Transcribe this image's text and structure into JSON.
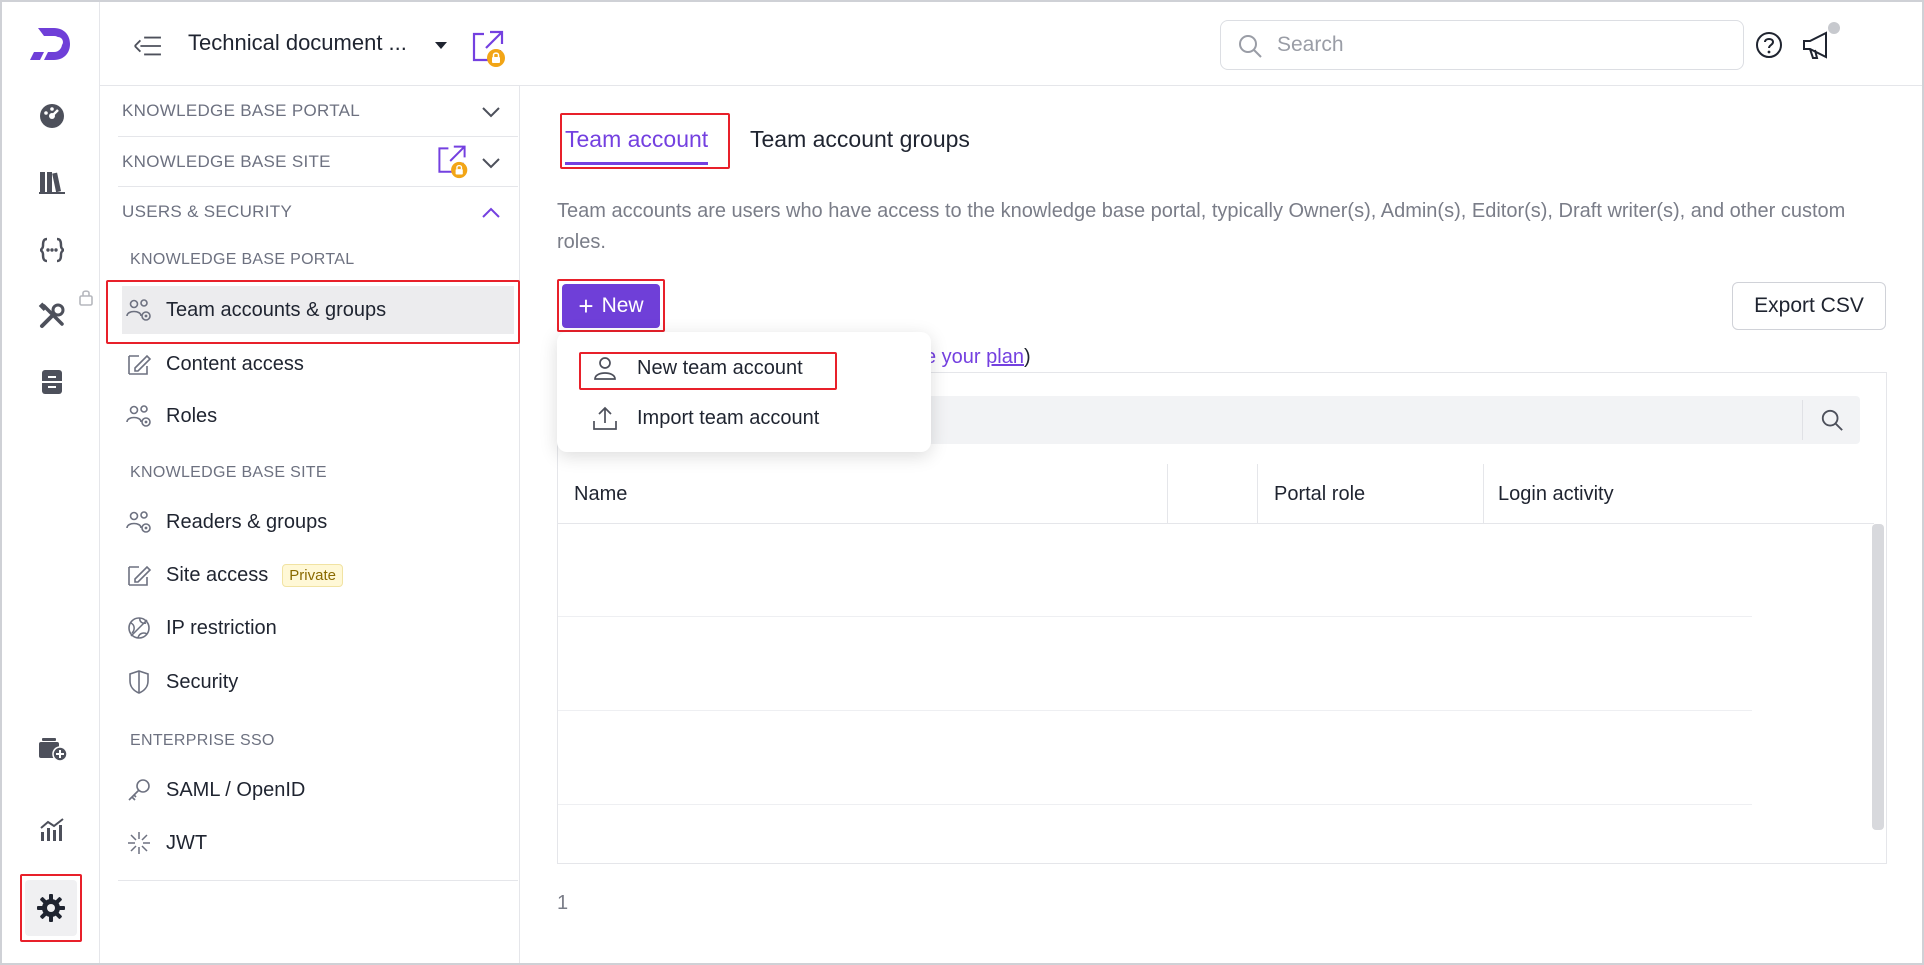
{
  "app": {
    "project_name": "Technical document ...",
    "search_placeholder": "Search"
  },
  "rail": {
    "items": [
      "dashboard-icon",
      "library-icon",
      "api-icon",
      "tools-icon",
      "archive-icon",
      "add-workspace-icon",
      "analytics-icon",
      "settings-icon"
    ]
  },
  "sidebar": {
    "sections": [
      {
        "label": "KNOWLEDGE BASE PORTAL",
        "expanded": false
      },
      {
        "label": "KNOWLEDGE BASE SITE",
        "expanded": false
      },
      {
        "label": "USERS & SECURITY",
        "expanded": true
      }
    ],
    "groups": {
      "portal": "KNOWLEDGE BASE PORTAL",
      "site": "KNOWLEDGE BASE SITE",
      "sso": "ENTERPRISE SSO"
    },
    "items": {
      "team_accounts": "Team accounts & groups",
      "content_access": "Content access",
      "roles": "Roles",
      "readers": "Readers & groups",
      "site_access": "Site access",
      "site_access_badge": "Private",
      "ip_restriction": "IP restriction",
      "security": "Security",
      "saml": "SAML / OpenID",
      "jwt": "JWT"
    }
  },
  "main": {
    "tabs": [
      "Team account",
      "Team account groups"
    ],
    "description": "Team accounts are users who have access to the knowledge base portal, typically Owner(s), Admin(s), Editor(s), Draft writer(s), and other custom roles.",
    "new_button": "New",
    "export_button": "Export CSV",
    "plan_text_fragment": "e your",
    "plan_link": "plan",
    "plan_close": ")",
    "table": {
      "columns": [
        "Name",
        "",
        "Portal role",
        "Login activity"
      ]
    },
    "page_number": "1"
  },
  "dropdown": {
    "items": [
      "New team account",
      "Import team account"
    ]
  },
  "colors": {
    "accent": "#7440e0",
    "highlight": "#e8202a",
    "lock_badge": "#f2a516"
  }
}
